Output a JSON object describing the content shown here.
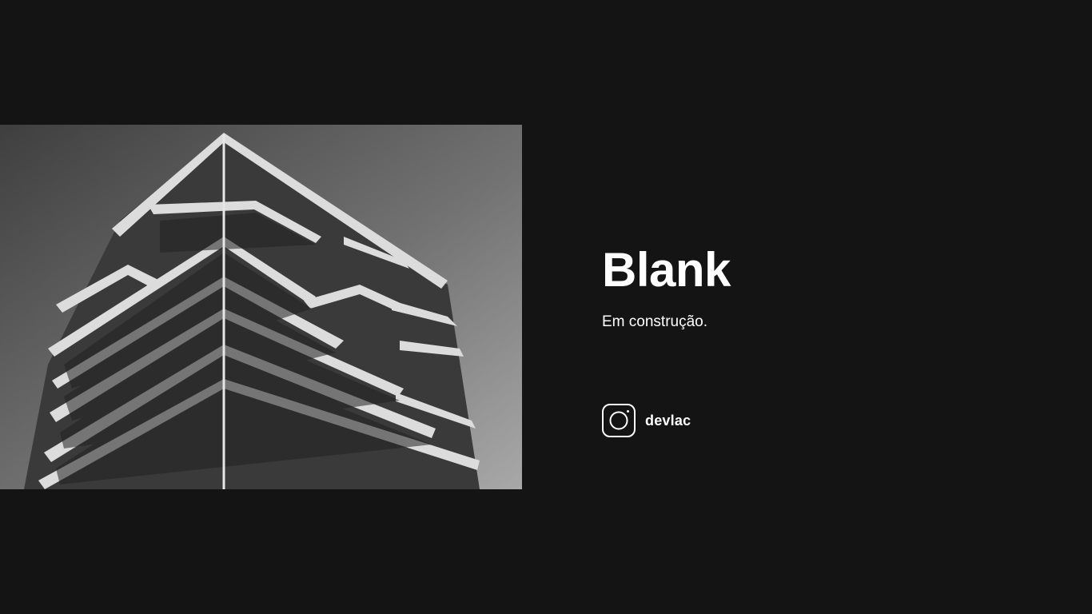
{
  "page": {
    "title": "Blank",
    "subtitle": "Em construção."
  },
  "hero_image": {
    "alt": "Black and white photo of a modern building with stacked balconies",
    "icon": "building-photo"
  },
  "social": {
    "icon": "instagram-icon",
    "handle": "devlac"
  },
  "colors": {
    "background": "#141414",
    "text": "#ffffff"
  }
}
